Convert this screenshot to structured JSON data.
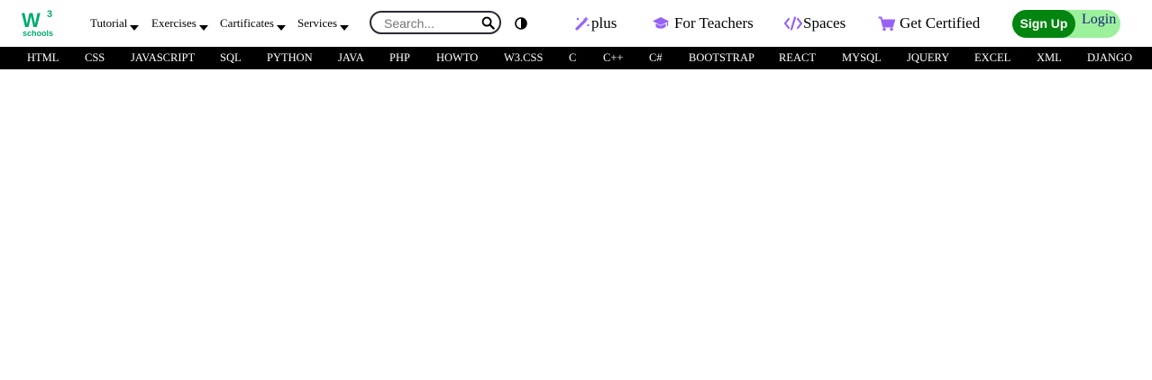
{
  "logo": {
    "mark": "W",
    "superscript": "3",
    "text": "schools"
  },
  "menu": [
    {
      "label": "Tutorial"
    },
    {
      "label": "Exercises"
    },
    {
      "label": "Cartificates"
    },
    {
      "label": "Services"
    }
  ],
  "search": {
    "placeholder": "Search...",
    "value": ""
  },
  "links": {
    "plus": "plus",
    "teachers": "For Teachers",
    "spaces": "Spaces",
    "certified": "Get Certified"
  },
  "auth": {
    "signup": "Sign Up",
    "login": "Login"
  },
  "nav": [
    "HTML",
    "CSS",
    "JAVASCRIPT",
    "SQL",
    "PYTHON",
    "JAVA",
    "PHP",
    "HOWTO",
    "W3.CSS",
    "C",
    "C++",
    "C#",
    "BOOTSTRAP",
    "REACT",
    "MYSQL",
    "JQUERY",
    "EXCEL",
    "XML",
    "DJANGO"
  ],
  "colors": {
    "brand_green": "#04AA6D",
    "accent_purple": "#9763f6",
    "signup_bg": "#04850f",
    "auth_bg": "#9cf19c",
    "nav_bg": "#000000"
  },
  "icons": {
    "plus": "magic-wand-icon",
    "teachers": "graduation-cap-icon",
    "spaces": "code-icon",
    "certified": "shopping-cart-icon",
    "search": "search-icon",
    "theme": "contrast-icon"
  }
}
